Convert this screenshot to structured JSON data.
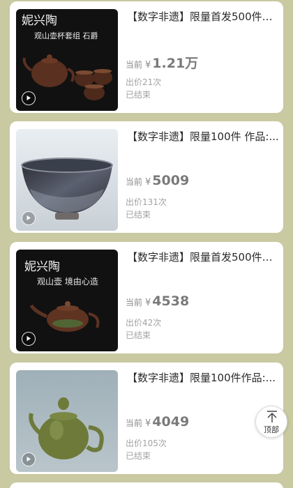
{
  "items": [
    {
      "title": "【数字非遗】限量首发500件三...",
      "price_label": "当前",
      "currency": "¥",
      "price": "1.21万",
      "bids": "出价21次",
      "status": "已结束",
      "image_text_line1": "妮兴陶",
      "image_text_line2": "观山壶杯套组 石爵"
    },
    {
      "title": "【数字非遗】限量100件 作品:...",
      "price_label": "当前",
      "currency": "¥",
      "price": "5009",
      "bids": "出价131次",
      "status": "已结束"
    },
    {
      "title": "【数字非遗】限量首发500件三...",
      "price_label": "当前",
      "currency": "¥",
      "price": "4538",
      "bids": "出价42次",
      "status": "已结束",
      "image_text_line1": "妮兴陶",
      "image_text_line2": "观山壶 境由心造"
    },
    {
      "title": "【数字非遗】限量100件作品:...",
      "price_label": "当前",
      "currency": "¥",
      "price": "4049",
      "bids": "出价105次",
      "status": "已结束"
    }
  ],
  "back_to_top_label": "顶部",
  "icons": {
    "play": "play-icon",
    "back_to_top": "arrow-up-icon"
  },
  "colors": {
    "background": "#c9c9a2",
    "card": "#ffffff",
    "price": "#7a7a7a"
  }
}
